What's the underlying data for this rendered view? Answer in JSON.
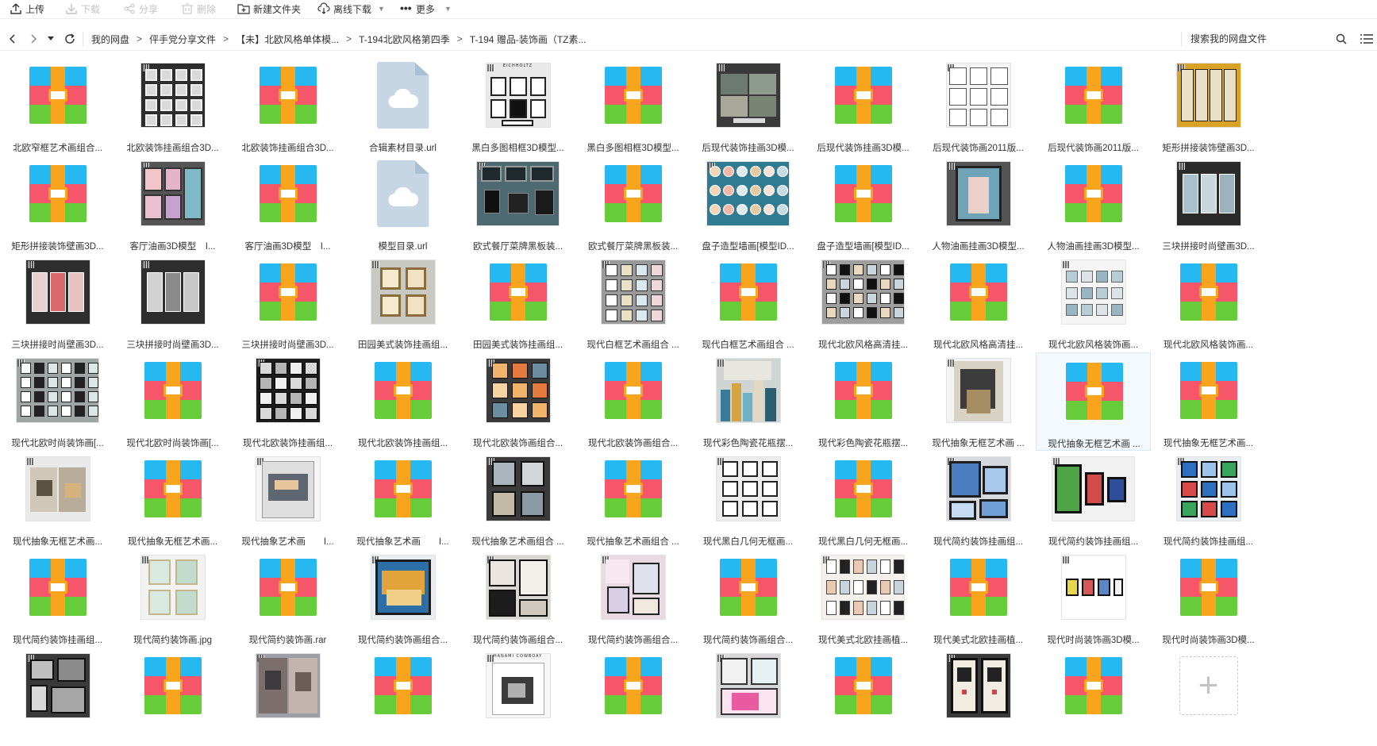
{
  "toolbar": {
    "upload": "上传",
    "download": "下载",
    "share": "分享",
    "delete": "删除",
    "new_folder": "新建文件夹",
    "offline_download": "离线下载",
    "more": "更多"
  },
  "breadcrumb": [
    "我的网盘",
    "伻手党分享文件",
    "【未】北欧风格单体模...",
    "T-194北欧风格第四季",
    "T-194 赠品-装饰画（TZ素..."
  ],
  "search": {
    "placeholder": "搜索我的网盘文件"
  },
  "files": [
    {
      "name": "北欧窄框艺术画组合...",
      "type": "archive"
    },
    {
      "name": "北欧装饰挂画组合3D...",
      "type": "image",
      "thumb": "grid-dark"
    },
    {
      "name": "北欧装饰挂画组合3D...",
      "type": "archive"
    },
    {
      "name": "合辑素材目录.url",
      "type": "url"
    },
    {
      "name": "黑白多图相框3D模型...",
      "type": "image",
      "thumb": "bw-frames",
      "caption": "EICHHOLTZ"
    },
    {
      "name": "黑白多图相框3D模型...",
      "type": "archive"
    },
    {
      "name": "后现代装饰挂画3D模...",
      "type": "image",
      "thumb": "landscape-trio"
    },
    {
      "name": "后现代装饰挂画3D模...",
      "type": "archive"
    },
    {
      "name": "后现代装饰画2011版...",
      "type": "image",
      "thumb": "bw-sketch"
    },
    {
      "name": "后现代装饰画2011版...",
      "type": "archive"
    },
    {
      "name": "矩形拼接装饰壁画3D...",
      "type": "image",
      "thumb": "gold-panels"
    },
    {
      "name": "矩形拼接装饰壁画3D...",
      "type": "archive"
    },
    {
      "name": "客厅油画3D模型　I...",
      "type": "image",
      "thumb": "pink-floral"
    },
    {
      "name": "客厅油画3D模型　I...",
      "type": "archive"
    },
    {
      "name": "模型目录.url",
      "type": "url"
    },
    {
      "name": "欧式餐厅菜牌黑板装...",
      "type": "image",
      "thumb": "blackboard-wide"
    },
    {
      "name": "欧式餐厅菜牌黑板装...",
      "type": "archive"
    },
    {
      "name": "盘子造型墙画[模型ID...",
      "type": "image",
      "thumb": "plates-wide"
    },
    {
      "name": "盘子造型墙画[模型ID...",
      "type": "archive"
    },
    {
      "name": "人物油画挂画3D模型...",
      "type": "image",
      "thumb": "portrait"
    },
    {
      "name": "人物油画挂画3D模型...",
      "type": "archive"
    },
    {
      "name": "三块拼接时尚壁画3D...",
      "type": "image",
      "thumb": "triptych-dark"
    },
    {
      "name": "三块拼接时尚壁画3D...",
      "type": "image",
      "thumb": "triptych-red"
    },
    {
      "name": "三块拼接时尚壁画3D...",
      "type": "image",
      "thumb": "triptych-gray"
    },
    {
      "name": "三块拼接时尚壁画3D...",
      "type": "archive"
    },
    {
      "name": "田园美式装饰挂画组...",
      "type": "image",
      "thumb": "botanical"
    },
    {
      "name": "田园美式装饰挂画组...",
      "type": "archive"
    },
    {
      "name": "现代白框艺术画组合 ...",
      "type": "image",
      "thumb": "white-frames"
    },
    {
      "name": "现代白框艺术画组合 ...",
      "type": "archive"
    },
    {
      "name": "现代北欧风格高清挂...",
      "type": "image",
      "thumb": "gallery-wall-wide"
    },
    {
      "name": "现代北欧风格高清挂...",
      "type": "archive"
    },
    {
      "name": "现代北欧风格装饰画...",
      "type": "image",
      "thumb": "light-grid"
    },
    {
      "name": "现代北欧风格装饰画...",
      "type": "archive"
    },
    {
      "name": "现代北欧时尚装饰画[...",
      "type": "image",
      "thumb": "gallery-gray-wide"
    },
    {
      "name": "现代北欧时尚装饰画[...",
      "type": "archive"
    },
    {
      "name": "现代北欧装饰挂画组...",
      "type": "image",
      "thumb": "winter-grid"
    },
    {
      "name": "现代北欧装饰挂画组...",
      "type": "archive"
    },
    {
      "name": "现代北欧装饰画组合...",
      "type": "image",
      "thumb": "sunset-grid"
    },
    {
      "name": "现代北欧装饰画组合...",
      "type": "archive"
    },
    {
      "name": "现代彩色陶瓷花瓶摆...",
      "type": "image",
      "thumb": "vases"
    },
    {
      "name": "现代彩色陶瓷花瓶摆...",
      "type": "archive"
    },
    {
      "name": "现代抽象无框艺术画 ...",
      "type": "image",
      "thumb": "abstract-tall"
    },
    {
      "name": "现代抽象无框艺术画 ...",
      "type": "archive",
      "selected": true
    },
    {
      "name": "现代抽象无框艺术画...",
      "type": "archive"
    },
    {
      "name": "现代抽象无框艺术画...",
      "type": "image",
      "thumb": "abstract-duo"
    },
    {
      "name": "现代抽象无框艺术画...",
      "type": "archive"
    },
    {
      "name": "现代抽象艺术画　　I...",
      "type": "image",
      "thumb": "abstract-smoke"
    },
    {
      "name": "现代抽象艺术画　　I...",
      "type": "archive"
    },
    {
      "name": "现代抽象艺术画组合 ...",
      "type": "image",
      "thumb": "abstract-quad"
    },
    {
      "name": "现代抽象艺术画组合 ...",
      "type": "archive"
    },
    {
      "name": "现代黑白几何无框画...",
      "type": "image",
      "thumb": "geometric"
    },
    {
      "name": "现代黑白几何无框画...",
      "type": "archive"
    },
    {
      "name": "现代简约装饰挂画组...",
      "type": "image",
      "thumb": "blue-frames"
    },
    {
      "name": "现代简约装饰挂画组...",
      "type": "image",
      "thumb": "green-frames-wide"
    },
    {
      "name": "现代简约装饰挂画组...",
      "type": "image",
      "thumb": "blue-grid"
    },
    {
      "name": "现代简约装饰挂画组...",
      "type": "archive"
    },
    {
      "name": "现代简约装饰画.jpg",
      "type": "image",
      "thumb": "leaves"
    },
    {
      "name": "现代简约装饰画.rar",
      "type": "archive"
    },
    {
      "name": "现代简约装饰画组合...",
      "type": "image",
      "thumb": "gold-wave"
    },
    {
      "name": "现代简约装饰画组合...",
      "type": "image",
      "thumb": "bw-circles"
    },
    {
      "name": "现代简约装饰画组合...",
      "type": "image",
      "thumb": "pastel"
    },
    {
      "name": "现代简约装饰画组合...",
      "type": "archive"
    },
    {
      "name": "现代美式北欧挂画植...",
      "type": "image",
      "thumb": "shelves-wide"
    },
    {
      "name": "现代美式北欧挂画植...",
      "type": "archive"
    },
    {
      "name": "现代时尚装饰画3D模...",
      "type": "image",
      "thumb": "small-frames"
    },
    {
      "name": "现代时尚装饰画3D模...",
      "type": "archive"
    },
    {
      "name": "",
      "type": "image",
      "thumb": "dark-room"
    },
    {
      "name": "",
      "type": "archive"
    },
    {
      "name": "",
      "type": "image",
      "thumb": "faces"
    },
    {
      "name": "",
      "type": "archive"
    },
    {
      "name": "",
      "type": "image",
      "thumb": "ink-poster",
      "caption": "HANAMI COWBOAY"
    },
    {
      "name": "",
      "type": "archive"
    },
    {
      "name": "",
      "type": "image",
      "thumb": "pink-elephant"
    },
    {
      "name": "",
      "type": "archive"
    },
    {
      "name": "",
      "type": "image",
      "thumb": "clock-frames"
    },
    {
      "name": "",
      "type": "archive"
    },
    {
      "name": "",
      "type": "add"
    }
  ],
  "colors": {
    "archive_blue": "#26b8f0",
    "archive_red": "#f5566a",
    "archive_green": "#66cc3a",
    "archive_orange": "#f9a41d",
    "url_doc": "#c6d6e4",
    "selection": "#f4f9ff"
  }
}
